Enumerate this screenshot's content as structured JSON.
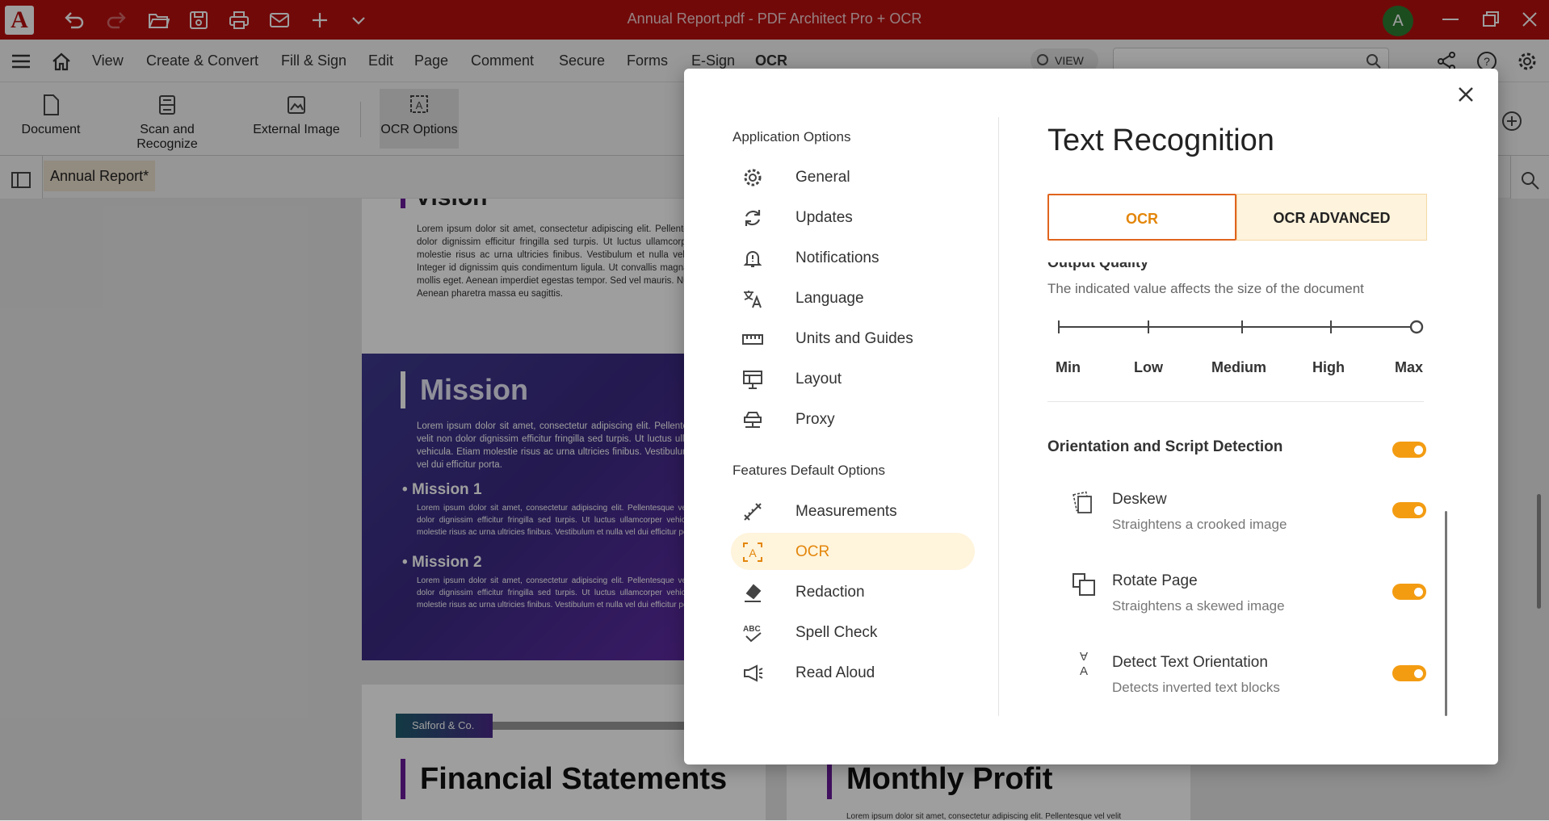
{
  "titlebar": {
    "title": "Annual Report.pdf  -  PDF Architect Pro + OCR",
    "avatar_letter": "A",
    "accent": "#b80f0f"
  },
  "menubar": {
    "items": [
      "View",
      "Create & Convert",
      "Fill & Sign",
      "Edit",
      "Page",
      "Comment",
      "Secure",
      "Forms",
      "E-Sign",
      "OCR"
    ],
    "view_toggle": "VIEW"
  },
  "ribbon": {
    "buttons": [
      "Document",
      "Scan and Recognize",
      "External Image",
      "OCR Options"
    ]
  },
  "doc_tab": "Annual Report*",
  "document": {
    "vision_heading": "Vision",
    "vision_text": "Lorem ipsum dolor sit amet, consectetur adipiscing elit. Pellentesque vel velit non dolor dignissim efficitur fringilla sed turpis. Ut luctus ullamcorper vehicula. Etiam molestie risus ac urna ultricies finibus. Vestibulum et nulla vel dui efficitur porta. Integer id dignissim quis condimentum ligula. Ut convallis magna sapien, a tempus mollis eget. Aenean imperdiet egestas tempor. Sed vel mauris. Nullam at diam dolor. Aenean pharetra massa eu sagittis.",
    "mission_heading": "Mission",
    "mission_text": "Lorem ipsum dolor sit amet, consectetur adipiscing elit. Pellentesque vel velit non dolor dignissim efficitur fringilla sed turpis. Ut luctus ullamcorper vehicula. Etiam molestie risus ac urna ultricies finibus. Vestibulum et nulla vel dui efficitur porta.",
    "mission1": "Mission 1",
    "mission1_text": "Lorem ipsum dolor sit amet, consectetur adipiscing elit. Pellentesque vel velit non dolor dignissim efficitur fringilla sed turpis. Ut luctus ullamcorper vehicula. Etiam molestie risus ac urna ultricies finibus. Vestibulum et nulla vel dui efficitur porta.",
    "mission2": "Mission 2",
    "mission2_text": "Lorem ipsum dolor sit amet, consectetur adipiscing elit. Pellentesque vel velit non dolor dignissim efficitur fringilla sed turpis. Ut luctus ullamcorper vehicula. Etiam molestie risus ac urna ultricies finibus. Vestibulum et nulla vel dui efficitur porta.",
    "company_tag": "Salford & Co.",
    "financial_heading": "Financial Statements",
    "monthly_heading": "Monthly Profit",
    "monthly_text": "Lorem ipsum dolor sit amet, consectetur adipiscing elit. Pellentesque vel velit"
  },
  "dialog": {
    "app_options_title": "Application Options",
    "app_options": [
      "General",
      "Updates",
      "Notifications",
      "Language",
      "Units and Guides",
      "Layout",
      "Proxy"
    ],
    "features_title": "Features Default Options",
    "features": [
      "Measurements",
      "OCR",
      "Redaction",
      "Spell Check",
      "Read Aloud"
    ],
    "heading": "Text Recognition",
    "tab_ocr": "OCR",
    "tab_advanced": "OCR ADVANCED",
    "quality_title": "Output Quality",
    "quality_desc": "The indicated value affects the size of the document",
    "quality_levels": [
      "Min",
      "Low",
      "Medium",
      "High",
      "Max"
    ],
    "quality_selected": "Max",
    "orientation_title": "Orientation and Script Detection",
    "orientation_enabled": true,
    "sub_options": [
      {
        "title": "Deskew",
        "desc": "Straightens a crooked image",
        "enabled": true
      },
      {
        "title": "Rotate Page",
        "desc": "Straightens a skewed image",
        "enabled": true
      },
      {
        "title": "Detect Text Orientation",
        "desc": "Detects inverted text blocks",
        "enabled": true
      }
    ],
    "accent": "#f39c12"
  }
}
